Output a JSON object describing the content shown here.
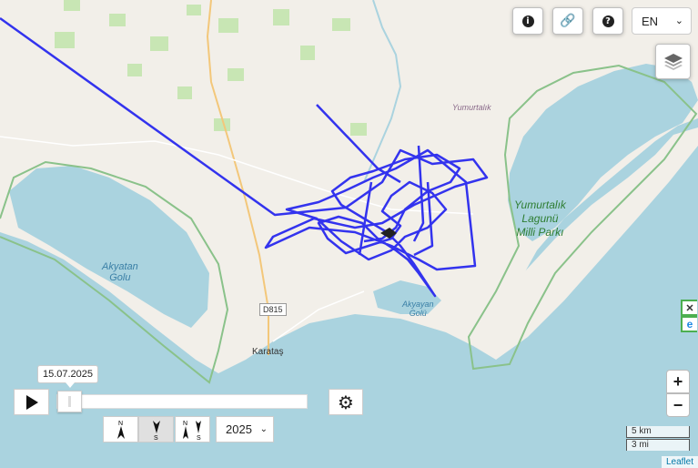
{
  "map": {
    "labels": {
      "akyatan_golu": "Akyatan\nGolu",
      "yumurtalik_town": "Yumurtalık",
      "yumurtalik_park": "Yumurtalık\nLagunü\nMilli Parkı",
      "akyayan_golu": "Akyayan\nGolü",
      "karatas": "Karataş",
      "road": "D815"
    },
    "colors": {
      "track": "#3333ee",
      "sea": "#aad3df",
      "land": "#f2efe9",
      "park": "#7fbf7f"
    }
  },
  "toolbar": {
    "info_icon": "info-icon",
    "link_icon": "link-icon",
    "help_icon": "help-icon",
    "language": "EN",
    "layers_icon": "layers-icon"
  },
  "playback": {
    "date": "15.07.2025",
    "year": "2025",
    "north_label": "N",
    "south_label": "S"
  },
  "zoom": {
    "in": "+",
    "out": "−"
  },
  "scale": {
    "km": "5 km",
    "mi": "3 mi"
  },
  "attribution": "Leaflet"
}
